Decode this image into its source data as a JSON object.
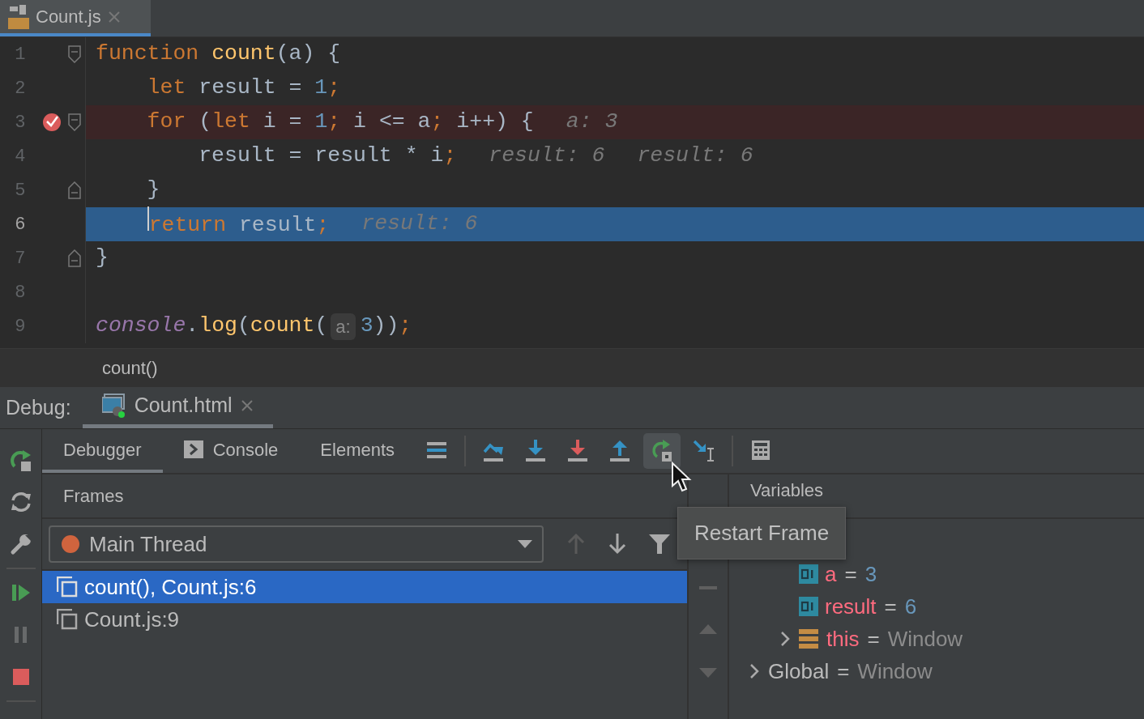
{
  "editor_tabs": [
    {
      "label": "Count.js",
      "selected": true
    }
  ],
  "code_lines": [
    {
      "number": "1",
      "breakpoint": false,
      "current": false,
      "caret": false,
      "fold_open": true,
      "tokens": [
        {
          "kind": "kw",
          "text": "function "
        },
        {
          "kind": "fn",
          "text": "count"
        },
        {
          "kind": "text",
          "text": "(a) {"
        }
      ]
    },
    {
      "number": "2",
      "breakpoint": false,
      "current": false,
      "caret": false,
      "tokens": [
        {
          "kind": "kw",
          "text": "    let"
        },
        {
          "kind": "text",
          "text": " result = "
        },
        {
          "kind": "num",
          "text": "1"
        },
        {
          "kind": "punct",
          "text": ";"
        }
      ]
    },
    {
      "number": "3",
      "breakpoint": true,
      "current": false,
      "caret": false,
      "fold_open": true,
      "tokens": [
        {
          "kind": "kw",
          "text": "    for"
        },
        {
          "kind": "text",
          "text": " ("
        },
        {
          "kind": "kw",
          "text": "let"
        },
        {
          "kind": "text",
          "text": " i = "
        },
        {
          "kind": "num",
          "text": "1"
        },
        {
          "kind": "punct",
          "text": ";"
        },
        {
          "kind": "text",
          "text": " i <= a"
        },
        {
          "kind": "punct",
          "text": ";"
        },
        {
          "kind": "text",
          "text": " i++) {"
        },
        {
          "kind": "hint",
          "text": "a: 3"
        }
      ]
    },
    {
      "number": "4",
      "breakpoint": false,
      "current": false,
      "caret": false,
      "tokens": [
        {
          "kind": "text",
          "text": "        result = result * i"
        },
        {
          "kind": "punct",
          "text": ";"
        },
        {
          "kind": "hint",
          "text": "result: 6"
        },
        {
          "kind": "hint",
          "text": "result: 6"
        }
      ]
    },
    {
      "number": "5",
      "breakpoint": false,
      "current": false,
      "caret": false,
      "fold_close": true,
      "tokens": [
        {
          "kind": "text",
          "text": "    }"
        }
      ]
    },
    {
      "number": "6",
      "breakpoint": false,
      "current": true,
      "caret": true,
      "tokens": [
        {
          "kind": "kw",
          "text": "    return"
        },
        {
          "kind": "text",
          "text": " result"
        },
        {
          "kind": "punct",
          "text": ";"
        },
        {
          "kind": "hint",
          "text": "result: 6"
        }
      ]
    },
    {
      "number": "7",
      "breakpoint": false,
      "current": false,
      "caret": false,
      "fold_close": true,
      "tokens": [
        {
          "kind": "text",
          "text": "}"
        }
      ]
    },
    {
      "number": "8",
      "breakpoint": false,
      "current": false,
      "caret": false
    },
    {
      "number": "9",
      "breakpoint": false,
      "current": false,
      "caret": false,
      "tokens": [
        {
          "kind": "global",
          "text": "console"
        },
        {
          "kind": "text",
          "text": "."
        },
        {
          "kind": "fn",
          "text": "log"
        },
        {
          "kind": "text",
          "text": "("
        },
        {
          "kind": "fn",
          "text": "count"
        },
        {
          "kind": "text",
          "text": "("
        },
        {
          "kind": "param",
          "text": "a:"
        },
        {
          "kind": "num",
          "text": "3"
        },
        {
          "kind": "text",
          "text": "))"
        },
        {
          "kind": "punct",
          "text": ";"
        }
      ]
    }
  ],
  "breadcrumb": "count()",
  "debug": {
    "label": "Debug:",
    "tabs": [
      {
        "label": "Count.html",
        "selected": true
      }
    ]
  },
  "left_toolbar": [
    {
      "kind": "rerun",
      "disabled": false
    },
    {
      "kind": "refresh",
      "disabled": false
    },
    {
      "kind": "settings",
      "disabled": false
    },
    {
      "kind": "resume",
      "disabled": false
    },
    {
      "kind": "pause",
      "disabled": true
    },
    {
      "kind": "stop",
      "disabled": false
    }
  ],
  "panel_tabs": [
    {
      "label": "Debugger",
      "selected": true,
      "icon": false
    },
    {
      "label": "Console",
      "selected": false,
      "icon": true
    },
    {
      "label": "Elements",
      "selected": false,
      "icon": false
    }
  ],
  "toolbar": [
    {
      "kind": "execution-point",
      "hovered": false
    },
    {
      "kind": "step-over",
      "hovered": false
    },
    {
      "kind": "step-into",
      "hovered": false
    },
    {
      "kind": "force-step-into",
      "hovered": false
    },
    {
      "kind": "step-out",
      "hovered": false
    },
    {
      "kind": "restart-frame",
      "hovered": true
    },
    {
      "kind": "run-to-cursor",
      "hovered": false
    },
    {
      "kind": "evaluate",
      "hovered": false
    }
  ],
  "tooltip": "Restart Frame",
  "frames": {
    "title": "Frames",
    "thread": {
      "label": "Main Thread",
      "color": "#d0643e"
    },
    "buttons": [
      {
        "kind": "up",
        "disabled": true
      },
      {
        "kind": "down",
        "disabled": false
      },
      {
        "kind": "filter",
        "disabled": false
      }
    ],
    "items": [
      {
        "label": "count(), Count.js:6",
        "selected": true
      },
      {
        "label": "Count.js:9",
        "selected": false
      }
    ]
  },
  "variables": {
    "title": "Variables",
    "tree": [
      {
        "kind": "scope",
        "expanded": true,
        "children": [
          {
            "kind": "primitive",
            "name": "a",
            "operator": "=",
            "value": "3"
          },
          {
            "kind": "primitive",
            "name": "result",
            "operator": "=",
            "value": "6"
          },
          {
            "kind": "object",
            "name": "this",
            "operator": "=",
            "value": "Window",
            "expanded": false
          }
        ]
      },
      {
        "kind": "scope",
        "name": "Global",
        "operator": "=",
        "value": "Window",
        "expanded": false
      }
    ]
  }
}
